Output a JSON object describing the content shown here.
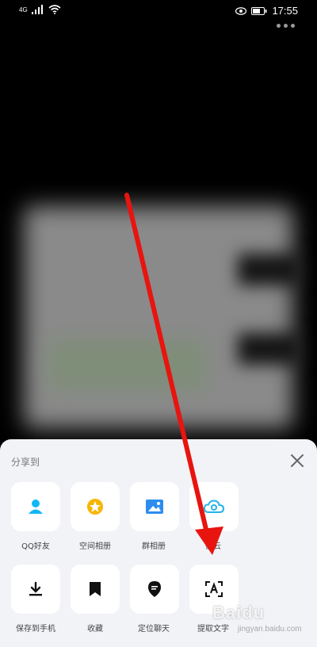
{
  "status_bar": {
    "time": "17:55",
    "network_label": "4G",
    "icons": [
      "signal-icon",
      "wifi-icon",
      "eye-icon",
      "battery-icon"
    ]
  },
  "share_sheet": {
    "title": "分享到",
    "row1": [
      {
        "label": "QQ好友",
        "icon": "person-icon",
        "color": "#12b7f5"
      },
      {
        "label": "空间相册",
        "icon": "qzone-star-icon",
        "color": "#f7b500"
      },
      {
        "label": "群相册",
        "icon": "image-icon",
        "color": "#2d8cf0"
      },
      {
        "label": "微云",
        "icon": "cloud-icon",
        "color": "#26b4e8"
      }
    ],
    "row2": [
      {
        "label": "保存到手机",
        "icon": "download-icon"
      },
      {
        "label": "收藏",
        "icon": "bookmark-icon"
      },
      {
        "label": "定位聊天",
        "icon": "location-chat-icon"
      },
      {
        "label": "提取文字",
        "icon": "text-scan-icon"
      }
    ]
  },
  "watermark": {
    "brand": "Baidu",
    "sub": "jingyan.baidu.com"
  },
  "colors": {
    "arrow": "#e8140f",
    "sheet_bg": "#f2f3f7"
  }
}
